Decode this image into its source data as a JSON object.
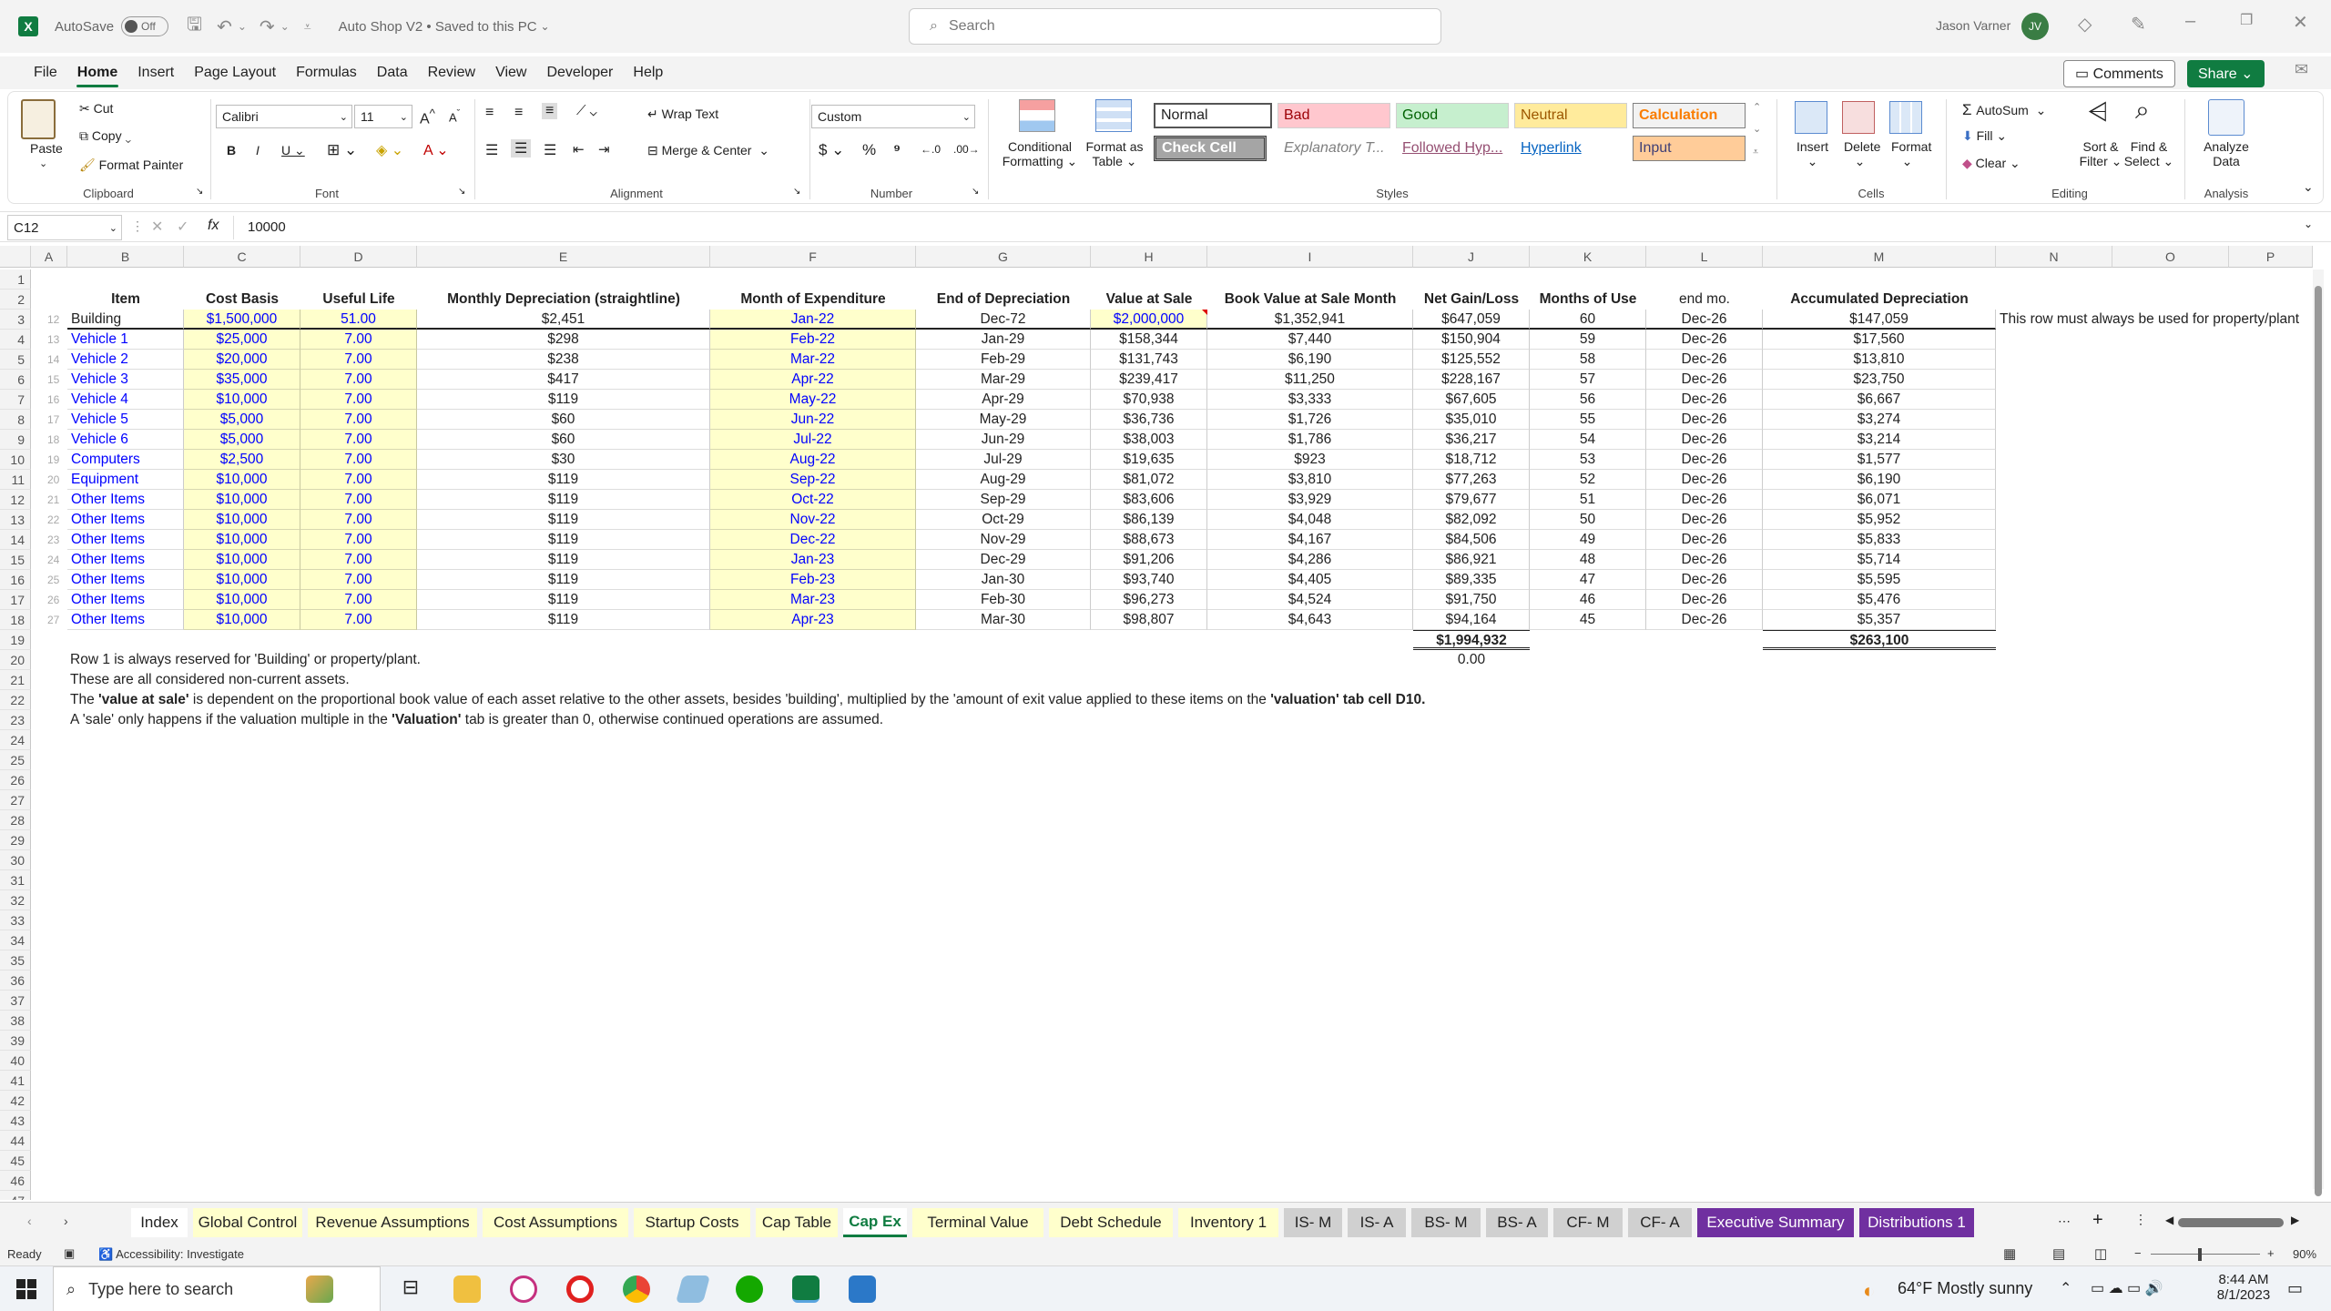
{
  "titlebar": {
    "autosave_label": "AutoSave",
    "autosave_state": "Off",
    "doc_title": "Auto Shop V2 • Saved to this PC",
    "search_placeholder": "Search",
    "user_name": "Jason Varner",
    "user_initials": "JV"
  },
  "menu": {
    "tabs": [
      "File",
      "Home",
      "Insert",
      "Page Layout",
      "Formulas",
      "Data",
      "Review",
      "View",
      "Developer",
      "Help"
    ],
    "comments": "Comments",
    "share": "Share"
  },
  "ribbon": {
    "clipboard": {
      "paste": "Paste",
      "cut": "Cut",
      "copy": "Copy",
      "format_painter": "Format Painter",
      "label": "Clipboard"
    },
    "font": {
      "name": "Calibri",
      "size": "11",
      "label": "Font"
    },
    "alignment": {
      "wrap": "Wrap Text",
      "merge": "Merge & Center",
      "label": "Alignment"
    },
    "number": {
      "format": "Custom",
      "label": "Number"
    },
    "styles": {
      "cond": "Conditional",
      "cond2": "Formatting",
      "fmt_table": "Format as",
      "fmt_table2": "Table",
      "label": "Styles",
      "cells": [
        {
          "text": "Normal",
          "bg": "#ffffff",
          "fg": "#000000"
        },
        {
          "text": "Bad",
          "bg": "#ffc7ce",
          "fg": "#9c0006"
        },
        {
          "text": "Good",
          "bg": "#c6efce",
          "fg": "#006100"
        },
        {
          "text": "Neutral",
          "bg": "#ffeb9c",
          "fg": "#9c5700"
        },
        {
          "text": "Calculation",
          "bg": "#f2f2f2",
          "fg": "#fa7d00"
        },
        {
          "text": "Check Cell",
          "bg": "#a5a5a5",
          "fg": "#ffffff"
        },
        {
          "text": "Explanatory T...",
          "bg": "#ffffff",
          "fg": "#7f7f7f"
        },
        {
          "text": "Followed Hyp...",
          "bg": "#ffffff",
          "fg": "#954f72"
        },
        {
          "text": "Hyperlink",
          "bg": "#ffffff",
          "fg": "#0563c1"
        },
        {
          "text": "Input",
          "bg": "#ffcc99",
          "fg": "#3f3f76"
        }
      ]
    },
    "cells": {
      "insert": "Insert",
      "delete": "Delete",
      "format": "Format",
      "label": "Cells"
    },
    "editing": {
      "autosum": "AutoSum",
      "fill": "Fill",
      "clear": "Clear",
      "sort": "Sort &",
      "sort2": "Filter",
      "find": "Find &",
      "find2": "Select",
      "label": "Editing"
    },
    "analysis": {
      "analyze": "Analyze",
      "analyze2": "Data",
      "label": "Analysis"
    }
  },
  "formula": {
    "namebox": "C12",
    "fx": "fx",
    "value": "10000"
  },
  "columns": [
    "A",
    "B",
    "C",
    "D",
    "E",
    "F",
    "G",
    "H",
    "I",
    "J",
    "K",
    "L",
    "M",
    "N",
    "O",
    "P"
  ],
  "headers": [
    "Item",
    "Cost Basis",
    "Useful Life",
    "Monthly Depreciation (straightline)",
    "Month of Expenditure",
    "End of Depreciation",
    "Value at Sale",
    "Book Value at Sale Month",
    "Net Gain/Loss",
    "Months of Use",
    "end mo.",
    "Accumulated Depreciation"
  ],
  "rows": [
    [
      "12",
      "Building",
      "$1,500,000",
      "51.00",
      "$2,451",
      "Jan-22",
      "Dec-72",
      "$2,000,000",
      "$1,352,941",
      "$647,059",
      "60",
      "Dec-26",
      "$147,059"
    ],
    [
      "13",
      "Vehicle 1",
      "$25,000",
      "7.00",
      "$298",
      "Feb-22",
      "Jan-29",
      "$158,344",
      "$7,440",
      "$150,904",
      "59",
      "Dec-26",
      "$17,560"
    ],
    [
      "14",
      "Vehicle 2",
      "$20,000",
      "7.00",
      "$238",
      "Mar-22",
      "Feb-29",
      "$131,743",
      "$6,190",
      "$125,552",
      "58",
      "Dec-26",
      "$13,810"
    ],
    [
      "15",
      "Vehicle 3",
      "$35,000",
      "7.00",
      "$417",
      "Apr-22",
      "Mar-29",
      "$239,417",
      "$11,250",
      "$228,167",
      "57",
      "Dec-26",
      "$23,750"
    ],
    [
      "16",
      "Vehicle 4",
      "$10,000",
      "7.00",
      "$119",
      "May-22",
      "Apr-29",
      "$70,938",
      "$3,333",
      "$67,605",
      "56",
      "Dec-26",
      "$6,667"
    ],
    [
      "17",
      "Vehicle 5",
      "$5,000",
      "7.00",
      "$60",
      "Jun-22",
      "May-29",
      "$36,736",
      "$1,726",
      "$35,010",
      "55",
      "Dec-26",
      "$3,274"
    ],
    [
      "18",
      "Vehicle 6",
      "$5,000",
      "7.00",
      "$60",
      "Jul-22",
      "Jun-29",
      "$38,003",
      "$1,786",
      "$36,217",
      "54",
      "Dec-26",
      "$3,214"
    ],
    [
      "19",
      "Computers",
      "$2,500",
      "7.00",
      "$30",
      "Aug-22",
      "Jul-29",
      "$19,635",
      "$923",
      "$18,712",
      "53",
      "Dec-26",
      "$1,577"
    ],
    [
      "20",
      "Equipment",
      "$10,000",
      "7.00",
      "$119",
      "Sep-22",
      "Aug-29",
      "$81,072",
      "$3,810",
      "$77,263",
      "52",
      "Dec-26",
      "$6,190"
    ],
    [
      "21",
      "Other Items",
      "$10,000",
      "7.00",
      "$119",
      "Oct-22",
      "Sep-29",
      "$83,606",
      "$3,929",
      "$79,677",
      "51",
      "Dec-26",
      "$6,071"
    ],
    [
      "22",
      "Other Items",
      "$10,000",
      "7.00",
      "$119",
      "Nov-22",
      "Oct-29",
      "$86,139",
      "$4,048",
      "$82,092",
      "50",
      "Dec-26",
      "$5,952"
    ],
    [
      "23",
      "Other Items",
      "$10,000",
      "7.00",
      "$119",
      "Dec-22",
      "Nov-29",
      "$88,673",
      "$4,167",
      "$84,506",
      "49",
      "Dec-26",
      "$5,833"
    ],
    [
      "24",
      "Other Items",
      "$10,000",
      "7.00",
      "$119",
      "Jan-23",
      "Dec-29",
      "$91,206",
      "$4,286",
      "$86,921",
      "48",
      "Dec-26",
      "$5,714"
    ],
    [
      "25",
      "Other Items",
      "$10,000",
      "7.00",
      "$119",
      "Feb-23",
      "Jan-30",
      "$93,740",
      "$4,405",
      "$89,335",
      "47",
      "Dec-26",
      "$5,595"
    ],
    [
      "26",
      "Other Items",
      "$10,000",
      "7.00",
      "$119",
      "Mar-23",
      "Feb-30",
      "$96,273",
      "$4,524",
      "$91,750",
      "46",
      "Dec-26",
      "$5,476"
    ],
    [
      "27",
      "Other Items",
      "$10,000",
      "7.00",
      "$119",
      "Apr-23",
      "Mar-30",
      "$98,807",
      "$4,643",
      "$94,164",
      "45",
      "Dec-26",
      "$5,357"
    ]
  ],
  "side_note": "This row must always be used for property/plant",
  "totals": {
    "net_gain": "$1,994,932",
    "accum": "$263,100",
    "check": "0.00"
  },
  "notes": [
    "Row 1 is always reserved for 'Building' or property/plant.",
    "These are all considered non-current assets."
  ],
  "note3": {
    "a": "The ",
    "b": "'value at sale'",
    "c": " is dependent on the proportional book value of each asset relative to the other assets, besides 'building', multiplied by the 'amount of exit value applied to these items on the ",
    "d": "'valuation' tab cell D10."
  },
  "note4": {
    "a": "A 'sale' only happens if the valuation multiple in the ",
    "b": "'Valuation'",
    "c": " tab is greater than 0, otherwise continued operations are assumed."
  },
  "sheet_tabs": [
    {
      "name": "Index",
      "style": "white"
    },
    {
      "name": "Global Control",
      "style": "yellow"
    },
    {
      "name": "Revenue Assumptions",
      "style": "yellow"
    },
    {
      "name": "Cost Assumptions",
      "style": "yellow"
    },
    {
      "name": "Startup Costs",
      "style": "yellow"
    },
    {
      "name": "Cap Table",
      "style": "yellow"
    },
    {
      "name": "Cap Ex",
      "style": "active"
    },
    {
      "name": "Terminal Value",
      "style": "yellow"
    },
    {
      "name": "Debt Schedule",
      "style": "yellow"
    },
    {
      "name": "Inventory 1",
      "style": "yellow"
    },
    {
      "name": "IS- M",
      "style": "grey"
    },
    {
      "name": "IS- A",
      "style": "grey"
    },
    {
      "name": "BS- M",
      "style": "grey"
    },
    {
      "name": "BS- A",
      "style": "grey"
    },
    {
      "name": "CF- M",
      "style": "grey"
    },
    {
      "name": "CF- A",
      "style": "grey"
    },
    {
      "name": "Executive Summary",
      "style": "purple"
    },
    {
      "name": "Distributions 1",
      "style": "purple"
    }
  ],
  "status": {
    "ready": "Ready",
    "accessibility": "Accessibility: Investigate",
    "zoom": "90%"
  },
  "taskbar": {
    "search": "Type here to search",
    "weather": "64°F  Mostly sunny",
    "time": "8:44 AM",
    "date": "8/1/2023"
  }
}
